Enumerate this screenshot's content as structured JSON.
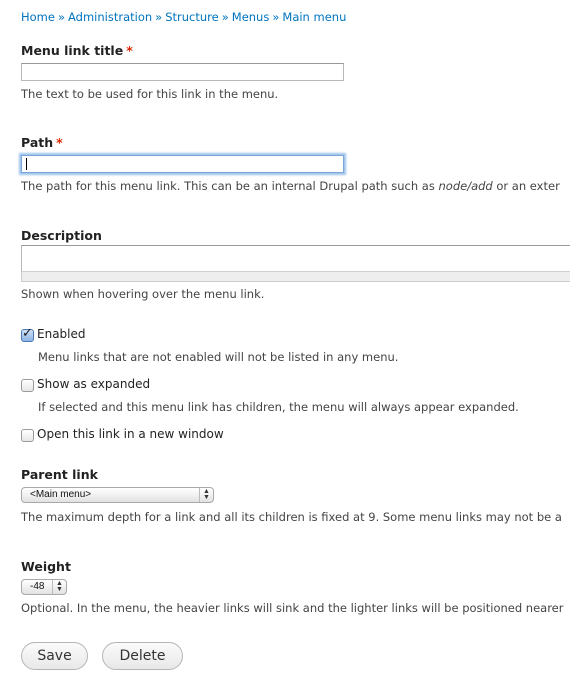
{
  "breadcrumb": {
    "items": [
      "Home",
      "Administration",
      "Structure",
      "Menus",
      "Main menu"
    ],
    "separator": "»"
  },
  "required_marker": "*",
  "menu_link_title": {
    "label": "Menu link title",
    "value": "",
    "description": "The text to be used for this link in the menu."
  },
  "path": {
    "label": "Path",
    "value": "",
    "description_pre": "The path for this menu link. This can be an internal Drupal path such as ",
    "description_em": "node/add",
    "description_post": " or an exter"
  },
  "description_field": {
    "label": "Description",
    "value": "",
    "description": "Shown when hovering over the menu link."
  },
  "enabled": {
    "label": "Enabled",
    "checked": true,
    "description": "Menu links that are not enabled will not be listed in any menu."
  },
  "expanded": {
    "label": "Show as expanded",
    "checked": false,
    "description": "If selected and this menu link has children, the menu will always appear expanded."
  },
  "new_window": {
    "label": "Open this link in a new window",
    "checked": false
  },
  "parent_link": {
    "label": "Parent link",
    "selected": "<Main menu>",
    "description": "The maximum depth for a link and all its children is fixed at 9. Some menu links may not be a"
  },
  "weight": {
    "label": "Weight",
    "selected": "-48",
    "description": "Optional. In the menu, the heavier links will sink and the lighter links will be positioned nearer"
  },
  "buttons": {
    "save": "Save",
    "delete": "Delete"
  },
  "colors": {
    "link": "#0074bd",
    "required": "#e32700",
    "focus": "#9ec2ea"
  },
  "icons": {
    "select_arrows": "▲▼"
  }
}
